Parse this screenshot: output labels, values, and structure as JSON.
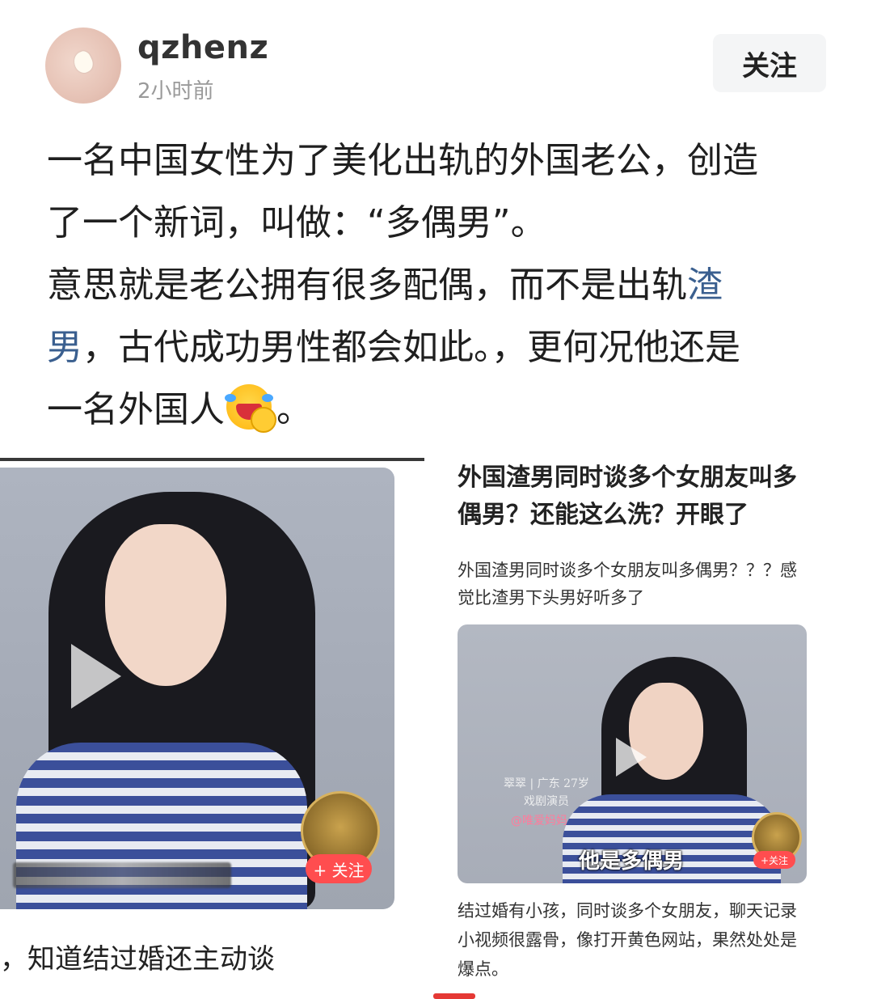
{
  "header": {
    "username": "qzhenz",
    "time": "2小时前",
    "follow_label": "关注"
  },
  "post": {
    "line1": "一名中国女性为了美化出轨的外国老公，创造",
    "line2": "了一个新词，叫做：“多偶男”。",
    "line3_a": "意思就是老公拥有很多配偶，而不是出轨",
    "line3_link": "渣",
    "line4_link": "男",
    "line4_b": "，古代成功男性都会如此。，更何况他还是",
    "line5_a": "一名外国人",
    "line5_b": "。",
    "emoji": "laughing-crying-emoji"
  },
  "left_card": {
    "follow_chip": "+ 关注",
    "caption": "，知道结过婚还主动谈"
  },
  "right_card": {
    "title": "外国渣男同时谈多个女朋友叫多偶男？还能这么洗？开眼了",
    "summary": "外国渣男同时谈多个女朋友叫多偶男？？？感觉比渣男下头男好听多了",
    "video_lower_third": "翠翠 | 广东 27岁 戏剧演员",
    "video_tag": "@唯爱妈妈",
    "video_subtitle": "他是多偶男",
    "follow_chip": "+关注",
    "description": "结过婚有小孩，同时谈多个女朋友，聊天记录小视频很露骨，像打开黄色网站，果然处处是爆点。"
  },
  "colors": {
    "link": "#3a5f8f",
    "follow_chip": "#ff4d4f",
    "accent_bar": "#e53935"
  }
}
